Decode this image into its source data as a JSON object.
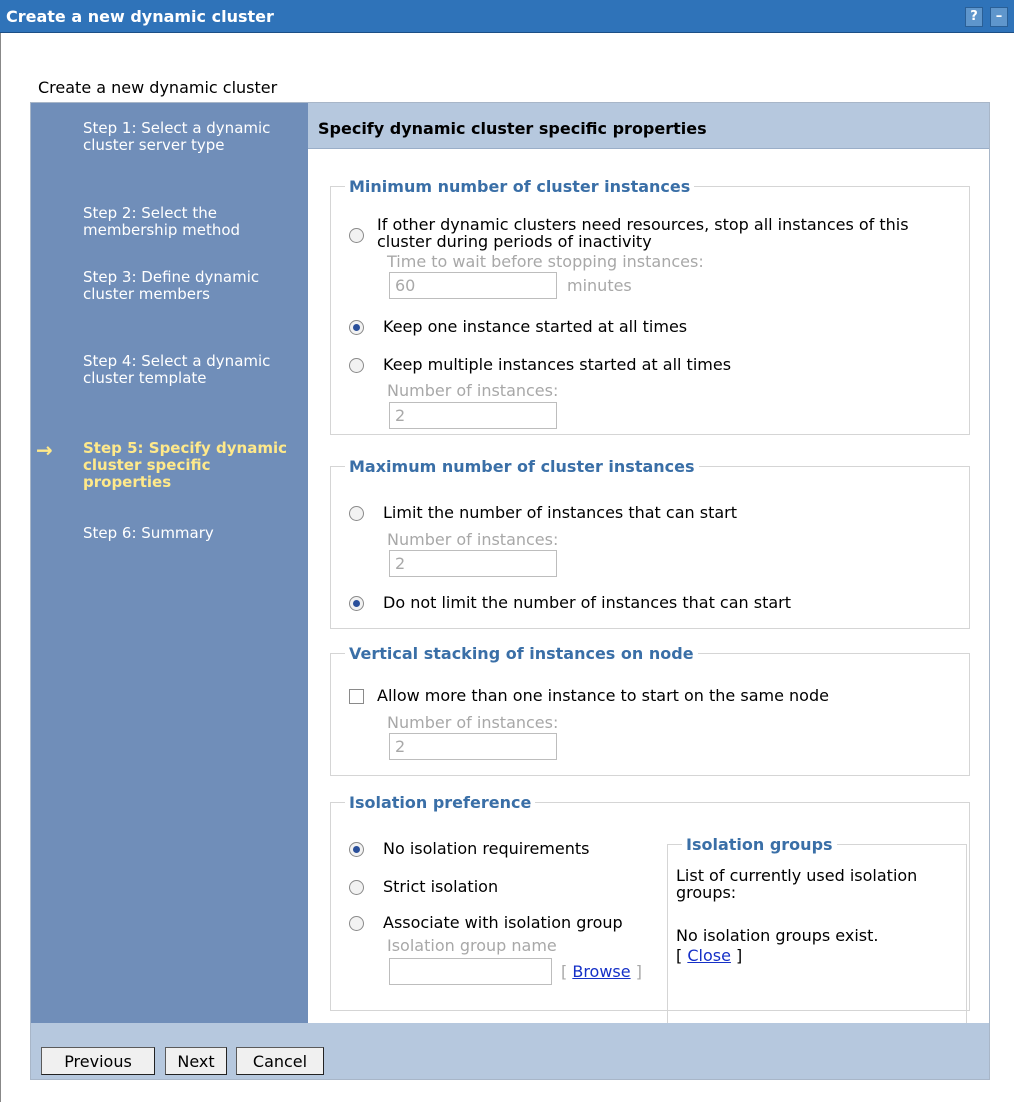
{
  "window": {
    "title": "Create a new dynamic cluster",
    "help_label": "?",
    "minimize_label": "–"
  },
  "page_heading": "Create a new dynamic cluster",
  "steps": [
    {
      "label": "Step 1: Select a dynamic cluster server type",
      "current": false
    },
    {
      "label": "Step 2: Select the membership method",
      "current": false
    },
    {
      "label": "Step 3: Define dynamic cluster members",
      "current": false
    },
    {
      "label": "Step 4: Select a dynamic cluster template",
      "current": false
    },
    {
      "label": "Step 5: Specify dynamic cluster specific properties",
      "current": true
    },
    {
      "label": "Step 6: Summary",
      "current": false
    }
  ],
  "current_step_arrow": "→",
  "content": {
    "header": "Specify dynamic cluster specific properties",
    "min_group": {
      "legend": "Minimum number of cluster instances",
      "opt_stop_all": "If other dynamic clusters need resources, stop all instances of this cluster during periods of inactivity",
      "wait_label": "Time to wait before stopping instances:",
      "wait_value": "60",
      "wait_unit": "minutes",
      "opt_keep_one": "Keep one instance started at all times",
      "opt_keep_multiple": "Keep multiple instances started at all times",
      "num_label": "Number of instances:",
      "num_value": "2",
      "selected": "keep_one"
    },
    "max_group": {
      "legend": "Maximum number of cluster instances",
      "opt_limit": "Limit the number of instances that can start",
      "num_label": "Number of instances:",
      "num_value": "2",
      "opt_no_limit": "Do not limit the number of instances that can start",
      "selected": "no_limit"
    },
    "vertical_group": {
      "legend": "Vertical stacking of instances on node",
      "opt_allow": "Allow more than one instance to start on the same node",
      "checked": false,
      "num_label": "Number of instances:",
      "num_value": "2"
    },
    "isolation_group": {
      "legend": "Isolation preference",
      "opt_none": "No isolation requirements",
      "opt_strict": "Strict isolation",
      "opt_associate": "Associate with isolation group",
      "group_name_label": "Isolation group name",
      "group_name_value": "",
      "browse_open": "[",
      "browse_label": "Browse",
      "browse_close": "]",
      "selected": "none",
      "groups_box": {
        "title": "Isolation groups",
        "list_label": "List of currently used isolation groups:",
        "empty_text": "No isolation groups exist.",
        "close_open": "[",
        "close_label": "Close",
        "close_close": "]"
      }
    }
  },
  "footer": {
    "previous_label": "Previous",
    "next_label": "Next",
    "cancel_label": "Cancel"
  }
}
